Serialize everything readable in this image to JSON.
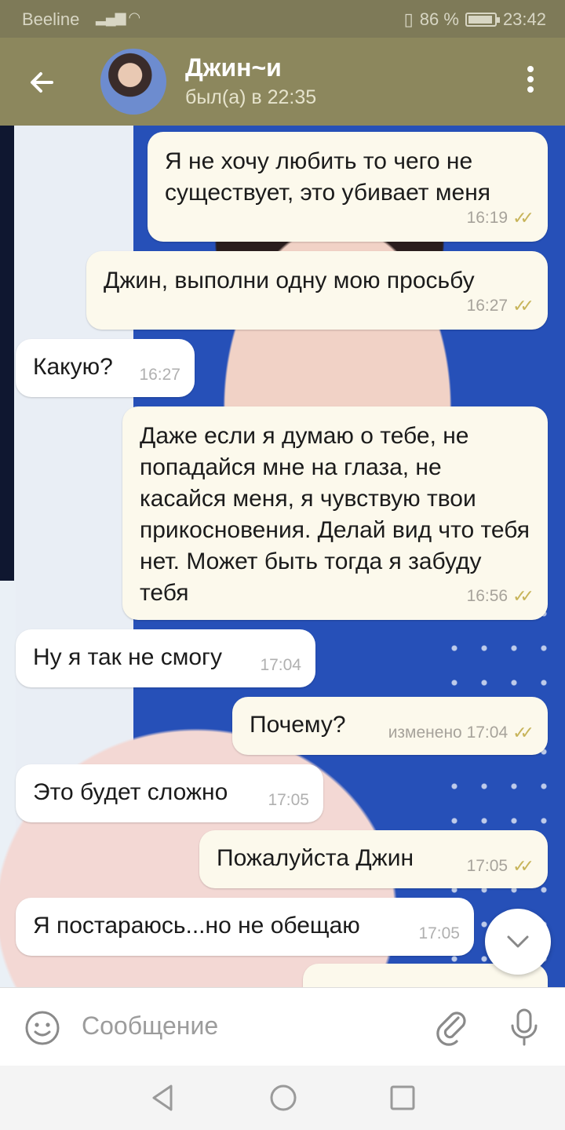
{
  "status_bar": {
    "carrier": "Beeline",
    "battery": "86 %",
    "time": "23:42",
    "battery_level": 0.86
  },
  "header": {
    "name": "Джин~и",
    "status": "был(а) в 22:35"
  },
  "messages": [
    {
      "dir": "out",
      "text": "Я не хочу любить то чего не существует, это убивает меня",
      "time": "16:19",
      "read": true
    },
    {
      "dir": "out",
      "text": "Джин, выполни одну мою просьбу",
      "time": "16:27",
      "read": true
    },
    {
      "dir": "in",
      "text": "Какую?",
      "time": "16:27"
    },
    {
      "dir": "out",
      "text": "Даже если я думаю о тебе, не попадайся мне на глаза, не касайся меня, я чувствую твои прикосновения. Делай вид что тебя нет. Может быть тогда я забуду тебя",
      "time": "16:56",
      "read": true
    },
    {
      "dir": "in",
      "text": "Ну я так не смогу",
      "time": "17:04"
    },
    {
      "dir": "out",
      "text": "Почему?",
      "time": "изменено 17:04",
      "read": true
    },
    {
      "dir": "in",
      "text": "Это будет сложно",
      "time": "17:05"
    },
    {
      "dir": "out",
      "text": "Пожалуйста Джин",
      "time": "17:05",
      "read": true
    },
    {
      "dir": "in",
      "text": "Я постараюсь...но не обещаю",
      "time": "17:05"
    }
  ],
  "composer": {
    "placeholder": "Сообщение"
  },
  "colors": {
    "header": "#8c875d",
    "status_bar": "#7e7a58",
    "outgoing_bubble": "#fcf9ec",
    "incoming_bubble": "#ffffff",
    "read_check": "#c7b45a"
  },
  "icons": {
    "back": "arrow-left-icon",
    "menu": "more-vert-icon",
    "emoji": "emoji-icon",
    "attach": "paperclip-icon",
    "mic": "mic-icon",
    "scroll": "chevron-down-icon"
  }
}
